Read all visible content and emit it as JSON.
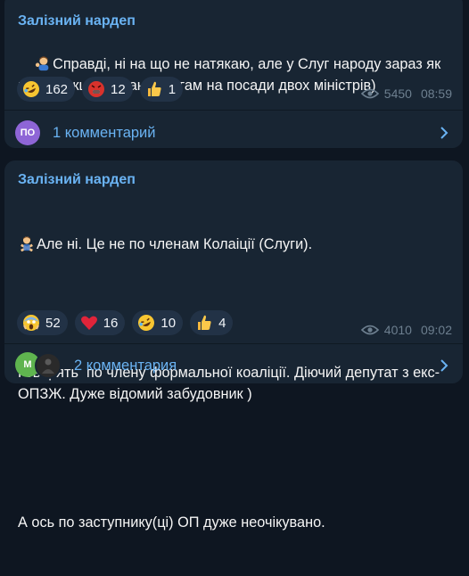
{
  "posts": [
    {
      "author": "Залізний нардеп",
      "text": "Справді, ні на що не натякаю, але у Слуг народу зараз як раз фракція по кандидатам на посади двох міністрів)",
      "reactions": [
        {
          "emoji": "rofl-emoji",
          "count": "162"
        },
        {
          "emoji": "angry-emoji",
          "count": "12"
        },
        {
          "emoji": "thumbs-up-emoji",
          "count": "1"
        }
      ],
      "views": "5450",
      "time": "08:59",
      "comments": {
        "avatar_text": "ПО",
        "label": "1 комментарий"
      }
    },
    {
      "author": "Залізний нардеп",
      "lines": [
        "Але ні. Це не по членам Колаіції (Слуги).",
        "Говорять  по члену формальної коаліції. Діючий депутат з екс-ОПЗЖ. Дуже відомий забудовник )",
        "А ось по заступнику(ці) ОП дуже неочікувано."
      ],
      "reactions": [
        {
          "emoji": "scream-emoji",
          "count": "52"
        },
        {
          "emoji": "heart-emoji",
          "count": "16"
        },
        {
          "emoji": "rofl-emoji",
          "count": "10"
        },
        {
          "emoji": "thumbs-up-emoji",
          "count": "4"
        }
      ],
      "views": "4010",
      "time": "09:02",
      "comments": {
        "avatar_text": "M",
        "label": "2 комментария"
      }
    }
  ],
  "colors": {
    "background": "#0e1621",
    "bubble": "#182533",
    "accent": "#6ab3f3",
    "reaction_bg": "#223246",
    "avatar_po": "#8e65d6",
    "avatar_m": "#5fb44f"
  }
}
